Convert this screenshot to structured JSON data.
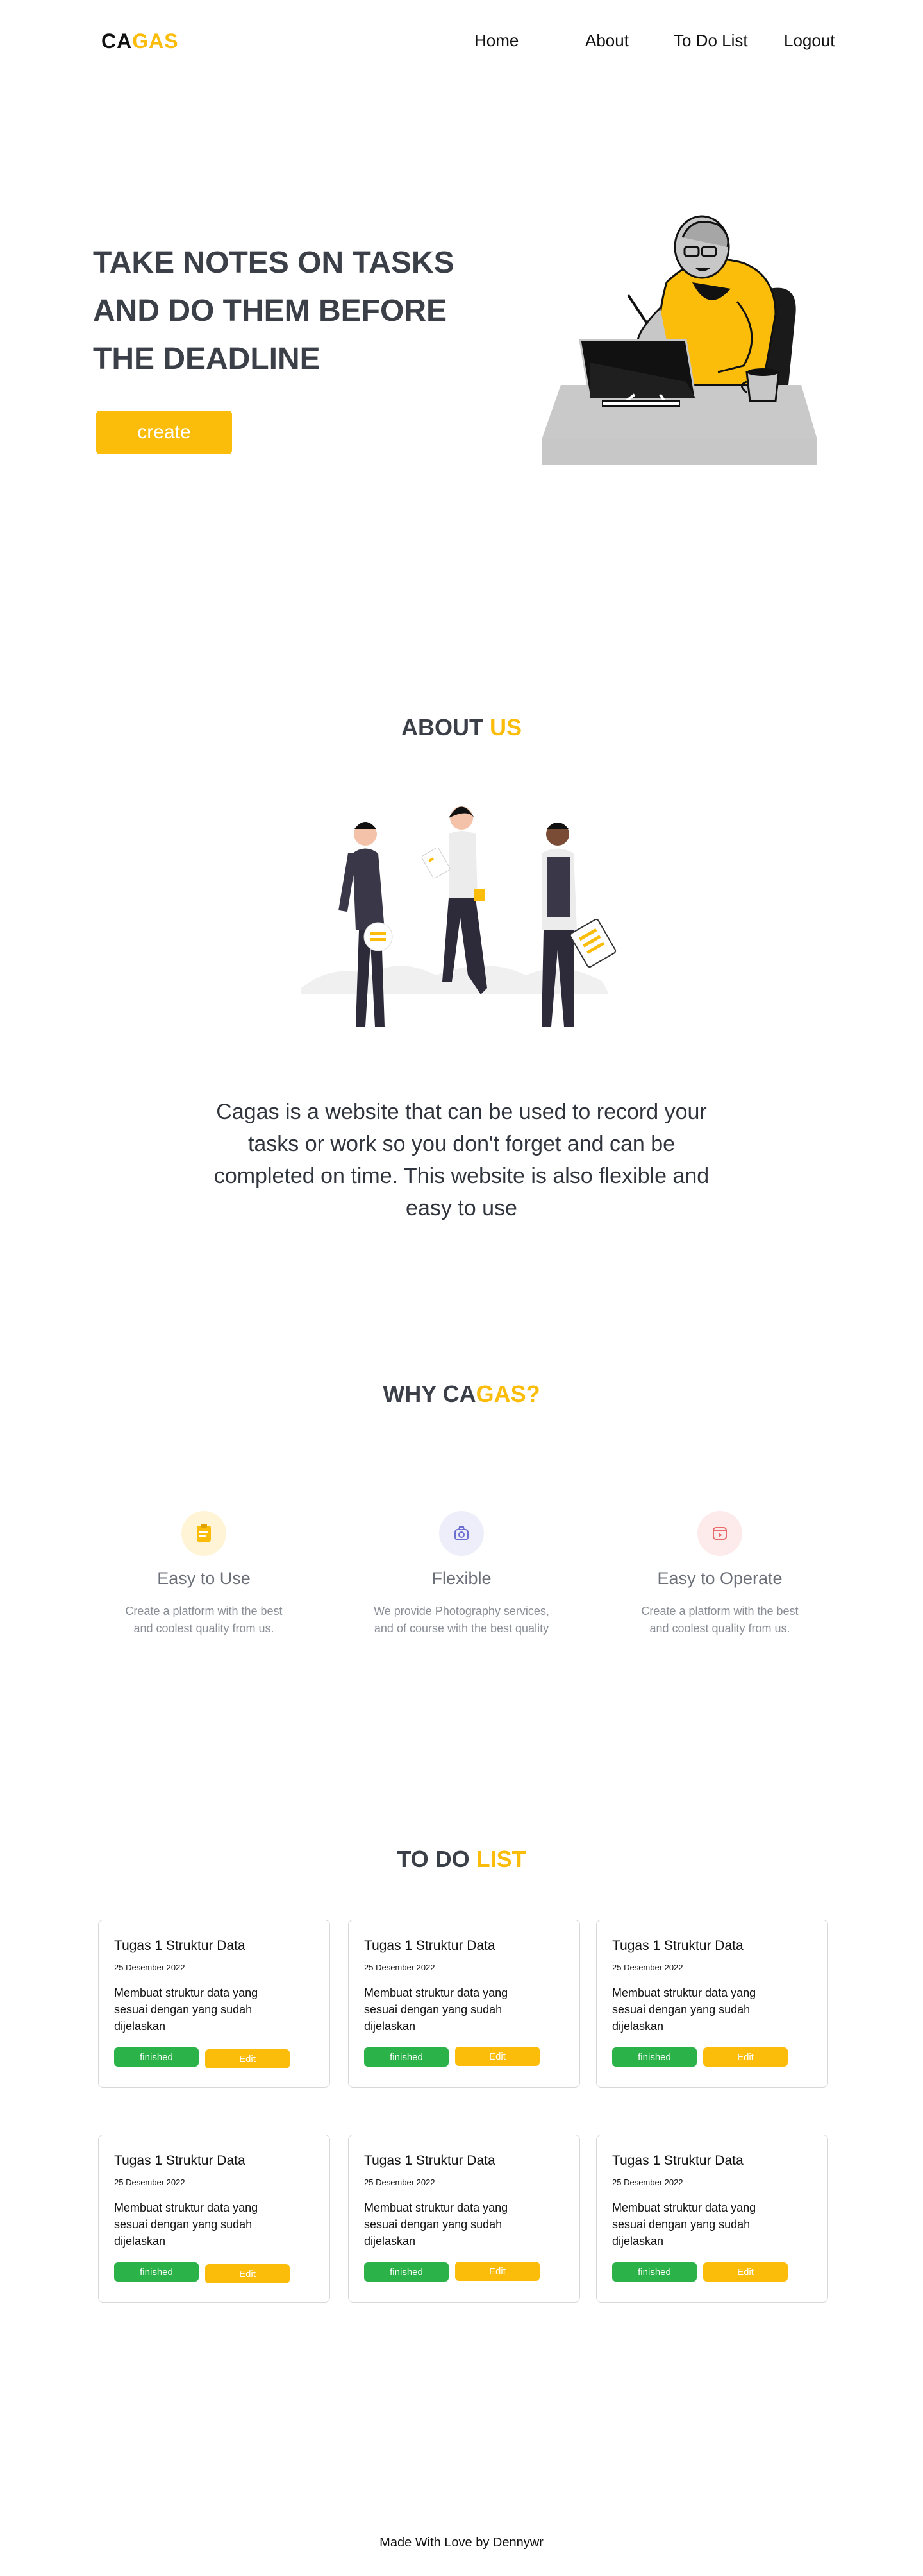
{
  "nav": {
    "logo_part1": "CA",
    "logo_part2": "GAS",
    "links": [
      "Home",
      "About",
      "To Do List",
      "Logout"
    ]
  },
  "hero": {
    "title_lines": [
      "TAKE NOTES ON TASKS",
      "AND DO THEM BEFORE",
      "THE DEADLINE"
    ],
    "button_label": "create",
    "illustration": "person-working-on-laptop-illustration"
  },
  "about": {
    "title_part1": "ABOUT ",
    "title_part2": "US",
    "illustration": "team-with-notes-illustration",
    "text": "Cagas is a website that can be used to record your tasks or work so you don't forget and can be completed on time. This website is also flexible and easy to use"
  },
  "why": {
    "title_part1": "WHY CA",
    "title_part2": "GAS?",
    "features": [
      {
        "title": "Easy to Use",
        "desc": "Create a platform with the best and coolest quality from us.",
        "icon": "notepad-icon",
        "color": "#fbbc0a",
        "bg": "#fff4d6"
      },
      {
        "title": "Flexible",
        "desc": "We provide Photography services, and of course with the best quality",
        "icon": "camera-bag-icon",
        "color": "#6a6fd0",
        "bg": "#eeeefa"
      },
      {
        "title": "Easy to Operate",
        "desc": "Create a platform with the best and coolest quality from us.",
        "icon": "video-play-icon",
        "color": "#e86a6a",
        "bg": "#fdeaea"
      }
    ]
  },
  "todo": {
    "title_part1": "TO DO ",
    "title_part2": "LIST",
    "cards": [
      {
        "title": "Tugas 1 Struktur Data",
        "date": "25 Desember 2022",
        "desc": "Membuat struktur data yang sesuai dengan yang sudah dijelaskan",
        "finished": "finished",
        "edit": "Edit"
      },
      {
        "title": "Tugas 1 Struktur Data",
        "date": "25 Desember 2022",
        "desc": "Membuat struktur data yang sesuai dengan yang sudah dijelaskan",
        "finished": "finished",
        "edit": "Edit"
      },
      {
        "title": "Tugas 1 Struktur Data",
        "date": "25 Desember 2022",
        "desc": "Membuat struktur data yang sesuai dengan yang sudah dijelaskan",
        "finished": "finished",
        "edit": "Edit"
      },
      {
        "title": "Tugas 1 Struktur Data",
        "date": "25 Desember 2022",
        "desc": "Membuat struktur data yang sesuai dengan yang sudah dijelaskan",
        "finished": "finished",
        "edit": "Edit"
      },
      {
        "title": "Tugas 1 Struktur Data",
        "date": "25 Desember 2022",
        "desc": "Membuat struktur data yang sesuai dengan yang sudah dijelaskan",
        "finished": "finished",
        "edit": "Edit"
      },
      {
        "title": "Tugas 1 Struktur Data",
        "date": "25 Desember 2022",
        "desc": "Membuat struktur data yang sesuai dengan yang sudah dijelaskan",
        "finished": "finished",
        "edit": "Edit"
      }
    ]
  },
  "footer": {
    "text": "Made With Love by Dennywr"
  },
  "colors": {
    "accent": "#fbbc0a",
    "success": "#2bb34a",
    "heading": "#3b3f47"
  }
}
